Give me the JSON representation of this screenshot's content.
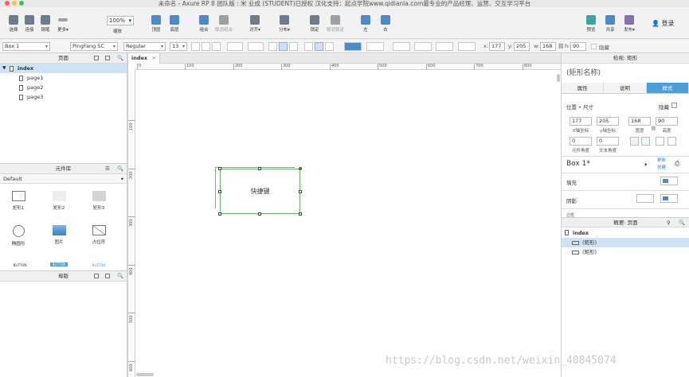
{
  "window": {
    "title": "未命名 - Axure RP 8 团队版 : 米 业成 (STUDENT)已授权 汉化支持：起点学院www.qidianla.com最专业的产品经理、运营、交互学习平台"
  },
  "toolbar": {
    "select": "选择",
    "connect": "连接",
    "pen": "钢笔",
    "more": "更多▾",
    "zoom_value": "100%",
    "zoom_label": "缩放",
    "top": "顶层",
    "bottom": "底层",
    "group": "组合",
    "ungroup": "取消组合",
    "align": "对齐▾",
    "distribute": "分布▾",
    "lock": "锁定",
    "unlock": "取消锁定",
    "left": "左",
    "right": "右",
    "preview": "预览",
    "share": "共享",
    "publish": "发布▾",
    "login": "登录"
  },
  "format": {
    "widget_name": "Box 1",
    "font": "PingFang SC",
    "weight": "Regular",
    "size": "13",
    "x_label": "x:",
    "x": "177",
    "y_label": "y:",
    "y": "205",
    "w_label": "w:",
    "w": "168",
    "h_label": "h:",
    "h": "90",
    "hidden": "隐藏"
  },
  "pages_panel": {
    "title": "页面",
    "root": "index",
    "pages": [
      "page1",
      "page2",
      "page3"
    ]
  },
  "library_panel": {
    "title": "元件库",
    "library": "Default",
    "widgets": [
      "矩形1",
      "矩形2",
      "矩形3",
      "椭圆形",
      "图片",
      "占位符"
    ],
    "button_label": "BUTTON"
  },
  "masters_panel": {
    "title": "母版"
  },
  "canvas": {
    "tab": "index",
    "tab_close": "×",
    "ruler_h": [
      "0",
      "100",
      "200",
      "300",
      "400",
      "500",
      "600",
      "700",
      "800"
    ],
    "ruler_v": [
      "100",
      "200",
      "300",
      "400",
      "500",
      "600"
    ],
    "box_text": "快捷键"
  },
  "inspector": {
    "title": "检视: 矩形",
    "shape_name": "(矩形名称)",
    "tabs": [
      "属性",
      "说明",
      "样式"
    ],
    "pos_size": "位置 • 尺寸",
    "hide": "隐藏",
    "x": "177",
    "y": "205",
    "w": "168",
    "h": "90",
    "x_lab": "X轴坐标",
    "y_lab": "y轴坐标",
    "w_lab": "宽度",
    "h_lab": "高度",
    "rot": "0",
    "text_rot": "0",
    "rot_lab": "元件角度",
    "text_rot_lab": "文本角度",
    "style_name": "Box 1*",
    "update": "更新",
    "create": "创建",
    "fill": "填充",
    "shadow": "阴影",
    "border": "边框"
  },
  "outline": {
    "title": "概要: 页面",
    "root": "index",
    "items": [
      "(矩形)",
      "(矩形)"
    ]
  },
  "watermark": "https://blog.csdn.net/weixin_40845074",
  "colors": {
    "accent": "#4a9fd8",
    "selection": "#5fb85f"
  }
}
